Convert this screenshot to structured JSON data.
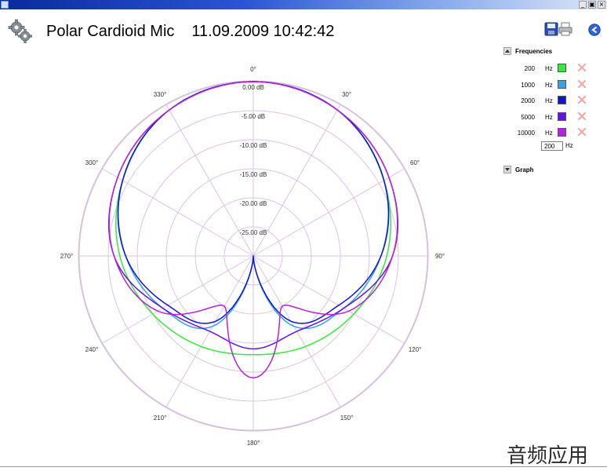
{
  "window": {
    "controls": [
      "_",
      "▣",
      "×"
    ]
  },
  "header": {
    "title": "Polar Cardioid Mic",
    "datetime": "11.09.2009 10:42:42",
    "icons": [
      "settings-gears-icon",
      "save-disk-icon",
      "print-icon",
      "back-arrow-icon"
    ]
  },
  "frequencies": {
    "label": "Frequencies",
    "items": [
      {
        "value": "200",
        "unit": "Hz",
        "color": "#35e83c"
      },
      {
        "value": "1000",
        "unit": "Hz",
        "color": "#2ea6e8"
      },
      {
        "value": "2000",
        "unit": "Hz",
        "color": "#1212d8"
      },
      {
        "value": "5000",
        "unit": "Hz",
        "color": "#6416d8"
      },
      {
        "value": "10000",
        "unit": "Hz",
        "color": "#b524d6"
      }
    ],
    "input_value": "200",
    "input_unit": "Hz"
  },
  "graph_section": {
    "label": "Graph"
  },
  "watermark": "音频应用",
  "chart_data": {
    "type": "polar",
    "angle_unit": "degrees",
    "angle_labels": [
      "0°",
      "30°",
      "60°",
      "90°",
      "120°",
      "150°",
      "180°",
      "210°",
      "240°",
      "270°",
      "300°",
      "330°"
    ],
    "radial_labels": [
      "0.00 dB",
      "-5.00 dB",
      "-10.00 dB",
      "-15.00 dB",
      "-20.00 dB",
      "-25.00 dB"
    ],
    "r_range_db": [
      -30,
      0
    ],
    "grid": true,
    "legend": "right-panel",
    "series": [
      {
        "name": "200",
        "color": "#35e83c",
        "angles": [
          0,
          30,
          60,
          90,
          120,
          150,
          180,
          210,
          240,
          270,
          300,
          330
        ],
        "db": [
          0,
          -1,
          -4,
          -7,
          -10,
          -12,
          -13,
          -12,
          -10,
          -7,
          -4,
          -1
        ]
      },
      {
        "name": "1000",
        "color": "#2ea6e8",
        "angles": [
          0,
          30,
          60,
          90,
          120,
          150,
          180,
          210,
          240,
          270,
          300,
          330
        ],
        "db": [
          0,
          -1,
          -4,
          -8,
          -12,
          -16,
          -30,
          -16,
          -12,
          -8,
          -4,
          -1
        ]
      },
      {
        "name": "2000",
        "color": "#1212d8",
        "angles": [
          0,
          30,
          60,
          90,
          120,
          150,
          180,
          210,
          240,
          270,
          300,
          330
        ],
        "db": [
          0,
          -1,
          -4,
          -8,
          -13,
          -17,
          -30,
          -17,
          -13,
          -8,
          -4,
          -1
        ]
      },
      {
        "name": "5000",
        "color": "#6416d8",
        "angles": [
          0,
          30,
          60,
          90,
          120,
          150,
          180,
          210,
          240,
          270,
          300,
          330
        ],
        "db": [
          0,
          -1,
          -3,
          -6,
          -12,
          -15,
          -14,
          -15,
          -12,
          -6,
          -3,
          -1
        ]
      },
      {
        "name": "10000",
        "color": "#b524d6",
        "angles": [
          0,
          30,
          60,
          90,
          120,
          150,
          180,
          210,
          240,
          270,
          300,
          330
        ],
        "db": [
          0,
          -1,
          -3,
          -6,
          -11,
          -20,
          -9,
          -20,
          -11,
          -6,
          -3,
          -1
        ]
      }
    ]
  }
}
